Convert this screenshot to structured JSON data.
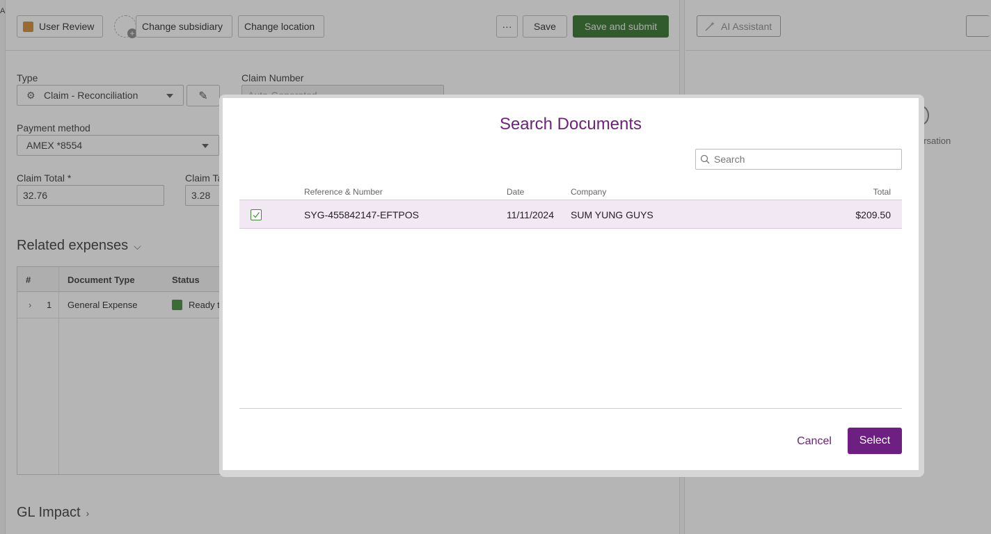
{
  "left_edge": {
    "label": "A"
  },
  "toolbar": {
    "status_label": "User Review",
    "change_subsidiary": "Change subsidiary",
    "change_location": "Change location",
    "more": "···",
    "save": "Save",
    "save_and_submit": "Save and submit"
  },
  "right_panel": {
    "ai_assistant": "AI Assistant",
    "conversation_hint": "ersation"
  },
  "form": {
    "type_label": "Type",
    "type_value": "Claim - Reconciliation",
    "claim_number_label": "Claim Number",
    "claim_number_placeholder": "Auto-Generated",
    "payment_method_label": "Payment method",
    "payment_method_value": "AMEX *8554",
    "claim_total_label": "Claim Total *",
    "claim_total_value": "32.76",
    "claim_tax_label": "Claim Tax",
    "claim_tax_value": "3.28"
  },
  "related_expenses": {
    "title": "Related expenses",
    "columns": {
      "num": "#",
      "doc_type": "Document Type",
      "status": "Status"
    },
    "rows": [
      {
        "num": "1",
        "doc_type": "General Expense",
        "status": "Ready to"
      }
    ]
  },
  "gl_impact": {
    "title": "GL Impact"
  },
  "modal": {
    "title": "Search Documents",
    "search_placeholder": "Search",
    "columns": {
      "reference": "Reference & Number",
      "date": "Date",
      "company": "Company",
      "total": "Total"
    },
    "rows": [
      {
        "reference": "SYG-455842147-EFTPOS",
        "date": "11/11/2024",
        "company": "SUM YUNG GUYS",
        "total": "$209.50",
        "checked": true
      }
    ],
    "cancel": "Cancel",
    "select": "Select"
  },
  "colors": {
    "accent_purple": "#6e1f82",
    "title_purple": "#6b2478",
    "success_green": "#2d6e24",
    "status_orange": "#d4882a",
    "selected_row_bg": "#f2e8f4"
  }
}
